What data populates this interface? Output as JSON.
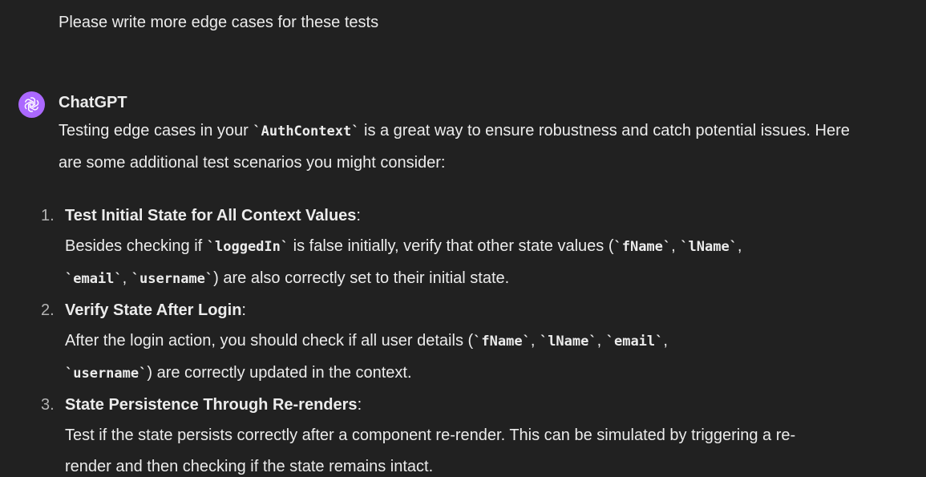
{
  "user_message": "Please write more edge cases for these tests",
  "assistant": {
    "name": "ChatGPT",
    "avatar_icon": "openai-logo-icon",
    "avatar_color": "#ab68ff",
    "intro": {
      "pre": "Testing edge cases in your ",
      "code": "`AuthContext`",
      "post": " is a great way to ensure robustness and catch potential issues. Here are some additional test scenarios you might consider:"
    },
    "items": [
      {
        "number": "1.",
        "title": "Test Initial State for All Context Values",
        "colon": ":",
        "text_1": "Besides checking if ",
        "code_1": "`loggedIn`",
        "text_2": " is false initially, verify that other state values (",
        "code_2": "`fName`",
        "sep_1": ", ",
        "code_3": "`lName`",
        "sep_2": ", ",
        "code_4": "`email`",
        "sep_3": ", ",
        "code_5": "`username`",
        "text_3": ") are also correctly set to their initial state."
      },
      {
        "number": "2.",
        "title": "Verify State After Login",
        "colon": ":",
        "text_1": "After the login action, you should check if all user details (",
        "code_1": "`fName`",
        "sep_1": ", ",
        "code_2": "`lName`",
        "sep_2": ", ",
        "code_3": "`email`",
        "sep_3": ", ",
        "code_4": "`username`",
        "text_2": ") are correctly updated in the context."
      },
      {
        "number": "3.",
        "title": "State Persistence Through Re-renders",
        "colon": ":",
        "text_1": "Test if the state persists correctly after a component re-render. This can be simulated by triggering a re-render and then checking if the state remains intact."
      }
    ]
  }
}
